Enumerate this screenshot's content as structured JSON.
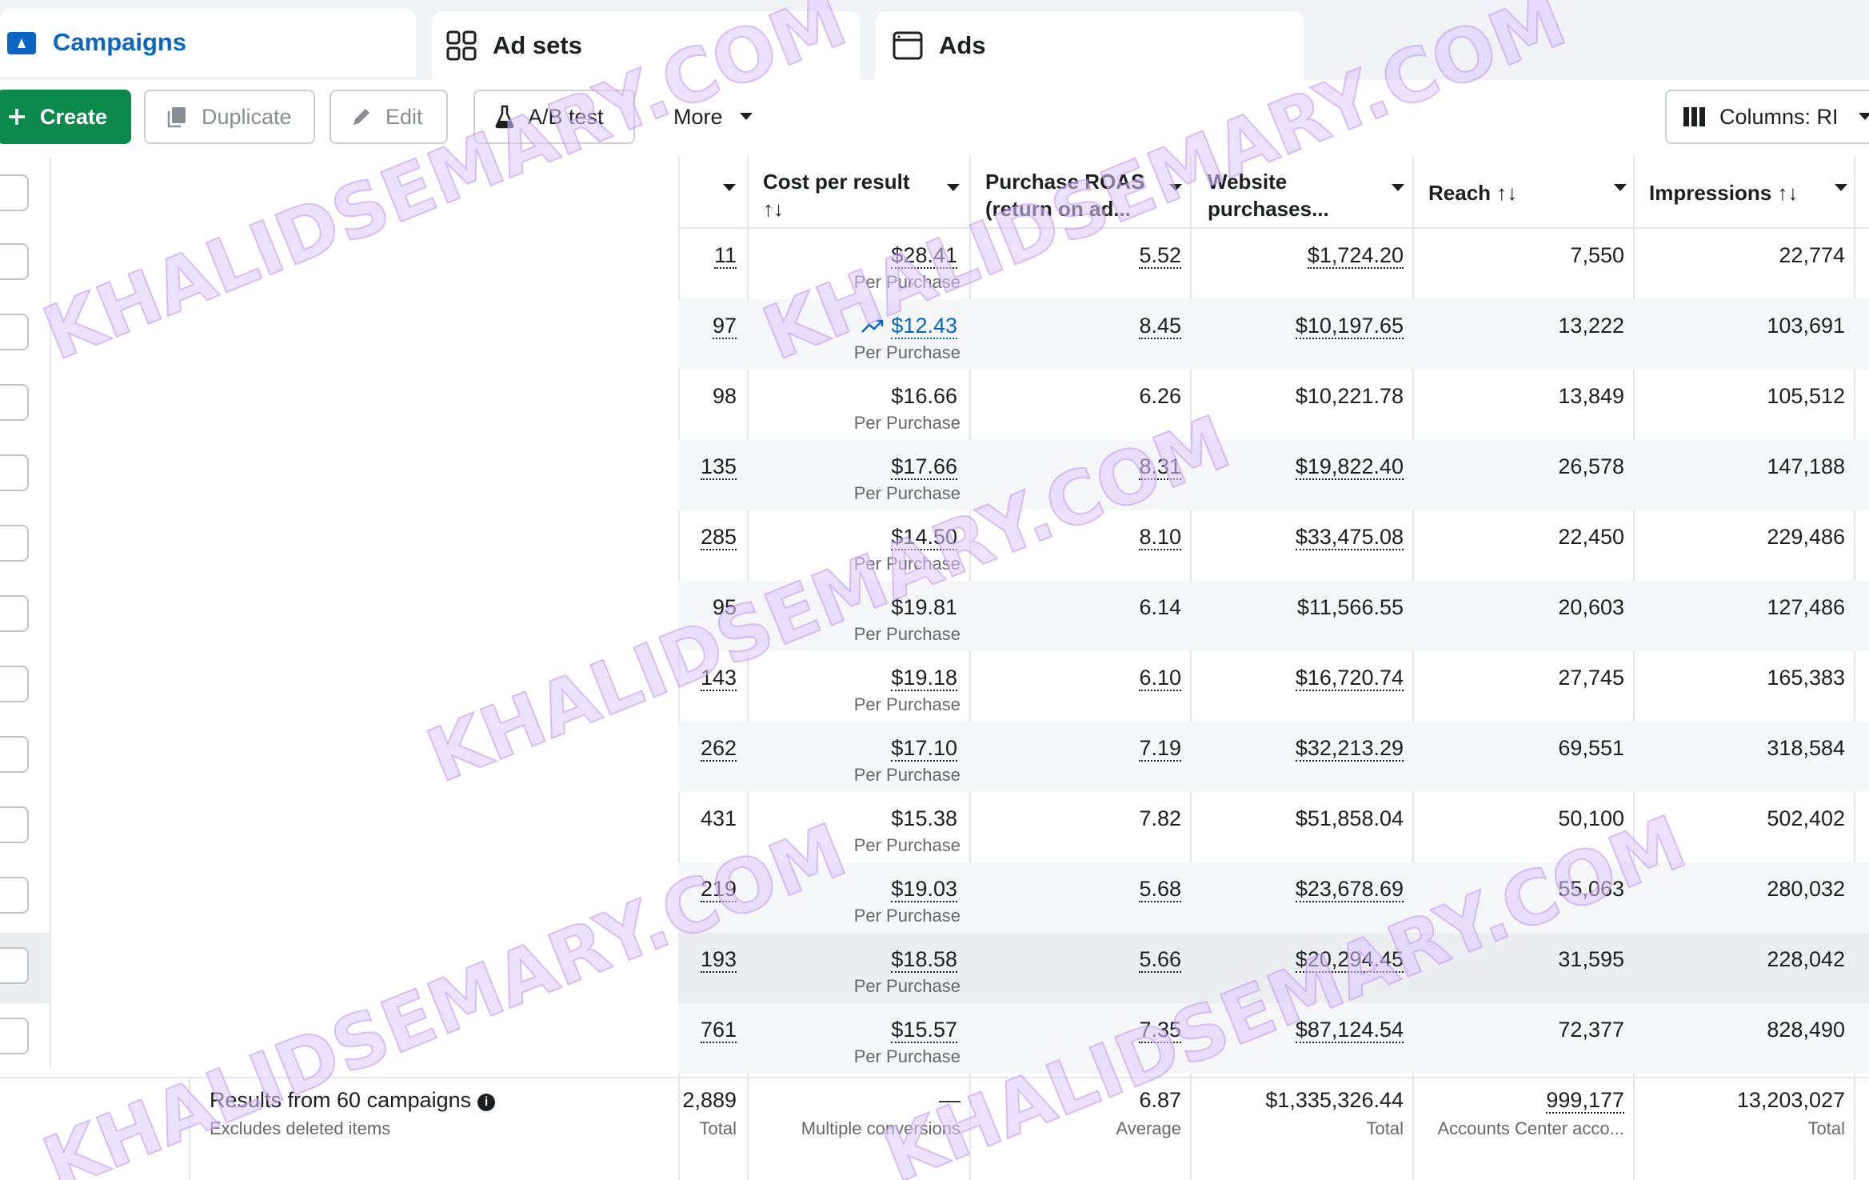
{
  "tabs": [
    {
      "label": "Campaigns",
      "icon": "campaign-folder-icon",
      "active": true
    },
    {
      "label": "Ad sets",
      "icon": "grid-icon",
      "active": false
    },
    {
      "label": "Ads",
      "icon": "ad-window-icon",
      "active": false
    }
  ],
  "toolbar": {
    "create_label": "Create",
    "duplicate_label": "Duplicate",
    "edit_label": "Edit",
    "abtest_label": "A/B test",
    "more_label": "More",
    "columns_label": "Columns: RI"
  },
  "columns": {
    "cost_per_result": {
      "line1": "Cost per result",
      "sort": "↑↓"
    },
    "purchase_roas": {
      "line1": "Purchase ROAS",
      "line2": "(return on ad..."
    },
    "website_purchases": {
      "line1": "Website",
      "line2": "purchases..."
    },
    "reach": {
      "line1": "Reach",
      "sort": "↑↓"
    },
    "impressions": {
      "line1": "Impressions",
      "sort": "↑↓"
    }
  },
  "rows": [
    {
      "results": "11",
      "cost": "$28.41",
      "cost_sub": "Per Purchase",
      "roas": "5.52",
      "purchases": "$1,724.20",
      "reach": "7,550",
      "impressions": "22,774"
    },
    {
      "results": "97",
      "cost": "$12.43",
      "cost_sub": "Per Purchase",
      "roas": "8.45",
      "purchases": "$10,197.65",
      "reach": "13,222",
      "impressions": "103,691"
    },
    {
      "results": "98",
      "cost": "$16.66",
      "cost_sub": "Per Purchase",
      "roas": "6.26",
      "purchases": "$10,221.78",
      "reach": "13,849",
      "impressions": "105,512"
    },
    {
      "results": "135",
      "cost": "$17.66",
      "cost_sub": "Per Purchase",
      "roas": "8.31",
      "purchases": "$19,822.40",
      "reach": "26,578",
      "impressions": "147,188"
    },
    {
      "results": "285",
      "cost": "$14.50",
      "cost_sub": "Per Purchase",
      "roas": "8.10",
      "purchases": "$33,475.08",
      "reach": "22,450",
      "impressions": "229,486"
    },
    {
      "results": "95",
      "cost": "$19.81",
      "cost_sub": "Per Purchase",
      "roas": "6.14",
      "purchases": "$11,566.55",
      "reach": "20,603",
      "impressions": "127,486"
    },
    {
      "results": "143",
      "cost": "$19.18",
      "cost_sub": "Per Purchase",
      "roas": "6.10",
      "purchases": "$16,720.74",
      "reach": "27,745",
      "impressions": "165,383"
    },
    {
      "results": "262",
      "cost": "$17.10",
      "cost_sub": "Per Purchase",
      "roas": "7.19",
      "purchases": "$32,213.29",
      "reach": "69,551",
      "impressions": "318,584"
    },
    {
      "results": "431",
      "cost": "$15.38",
      "cost_sub": "Per Purchase",
      "roas": "7.82",
      "purchases": "$51,858.04",
      "reach": "50,100",
      "impressions": "502,402"
    },
    {
      "results": "219",
      "cost": "$19.03",
      "cost_sub": "Per Purchase",
      "roas": "5.68",
      "purchases": "$23,678.69",
      "reach": "55,063",
      "impressions": "280,032"
    },
    {
      "results": "193",
      "cost": "$18.58",
      "cost_sub": "Per Purchase",
      "roas": "5.66",
      "purchases": "$20,294.45",
      "reach": "31,595",
      "impressions": "228,042"
    },
    {
      "results": "761",
      "cost": "$15.57",
      "cost_sub": "Per Purchase",
      "roas": "7.35",
      "purchases": "$87,124.54",
      "reach": "72,377",
      "impressions": "828,490"
    }
  ],
  "footer": {
    "label": "Results from 60 campaigns",
    "sublabel": "Excludes deleted items",
    "results": "2,889",
    "results_sub": "Total",
    "cost": "—",
    "cost_sub": "Multiple conversions",
    "roas": "6.87",
    "roas_sub": "Average",
    "purchases": "$1,335,326.44",
    "purchases_sub": "Total",
    "reach": "999,177",
    "reach_sub": "Accounts Center acco...",
    "impressions": "13,203,027",
    "impressions_sub": "Total"
  },
  "watermark": "KHALIDSEMARY.COM",
  "colors": {
    "accent": "#0a66c2",
    "create_button": "#0b8a4c",
    "row_alt": "#f5f6f7",
    "row_hover": "#ebedf0",
    "watermark": "#dcc8ff"
  }
}
